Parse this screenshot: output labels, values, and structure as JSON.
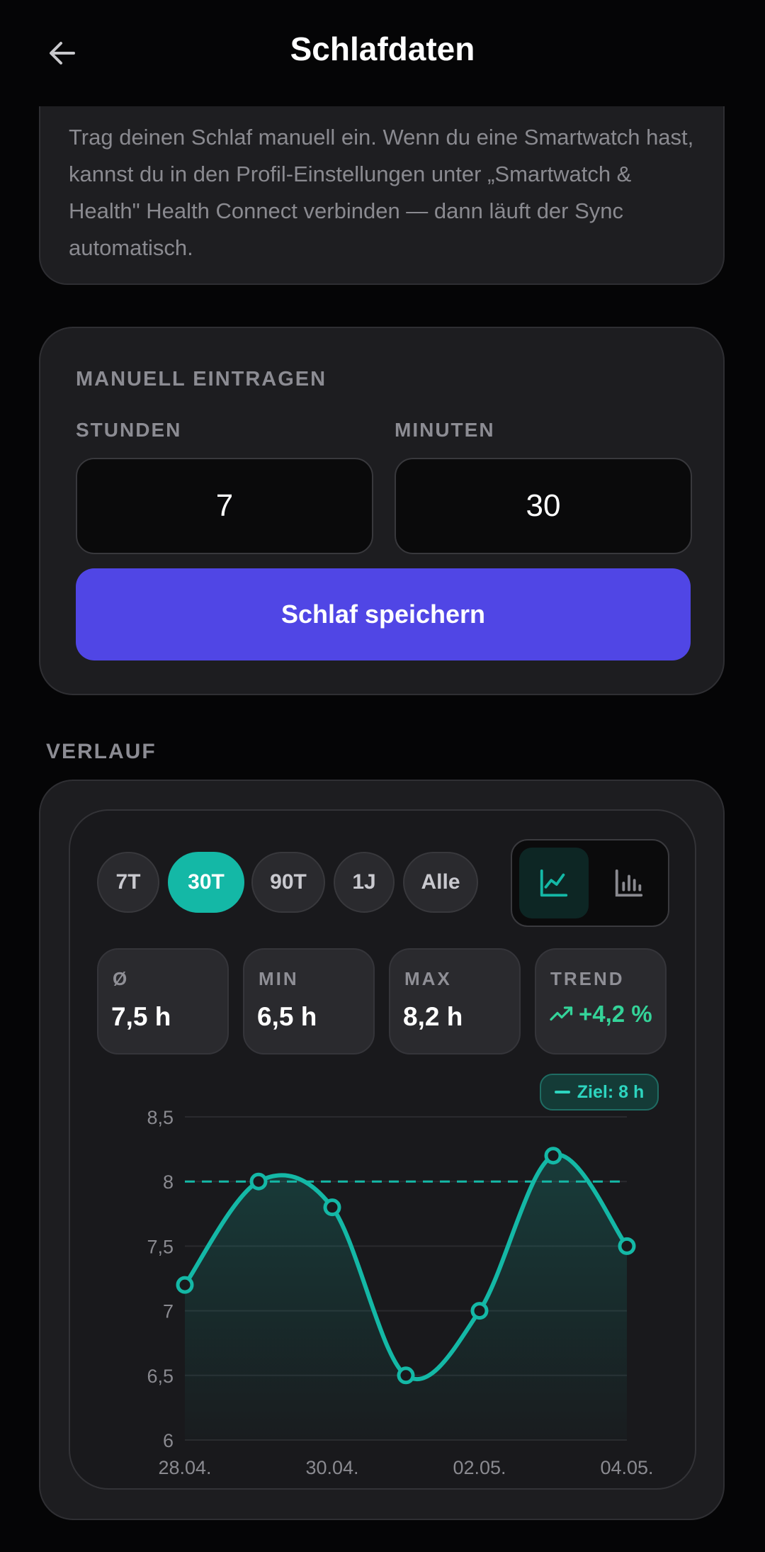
{
  "header": {
    "title": "Schlafdaten"
  },
  "info": {
    "text": "Trag deinen Schlaf manuell ein. Wenn du eine Smartwatch hast, kannst du in den Profil-Einstellungen unter „Smartwatch & Health\" Health Connect verbinden — dann läuft der Sync automatisch."
  },
  "entry": {
    "section_label": "MANUELL EINTRAGEN",
    "hours_label": "STUNDEN",
    "minutes_label": "MINUTEN",
    "hours_value": "7",
    "minutes_value": "30",
    "save_label": "Schlaf speichern"
  },
  "history": {
    "label": "VERLAUF",
    "ranges": [
      {
        "label": "7T",
        "active": false
      },
      {
        "label": "30T",
        "active": true
      },
      {
        "label": "90T",
        "active": false
      },
      {
        "label": "1J",
        "active": false
      },
      {
        "label": "Alle",
        "active": false
      }
    ],
    "view_modes": [
      {
        "icon": "line-chart-icon",
        "active": true
      },
      {
        "icon": "bar-chart-icon",
        "active": false
      }
    ],
    "stats": [
      {
        "label": "Ø",
        "value": "7,5 h"
      },
      {
        "label": "MIN",
        "value": "6,5 h"
      },
      {
        "label": "MAX",
        "value": "8,2 h"
      },
      {
        "label": "TREND",
        "value": "+4,2 %",
        "icon": "trend-up-icon"
      }
    ],
    "goal_badge": "Ziel: 8 h"
  },
  "colors": {
    "accent": "#14b8a6",
    "primary": "#5046e5",
    "trend": "#34d399"
  },
  "chart_data": {
    "type": "line",
    "x": [
      "28.04.",
      "29.04.",
      "30.04.",
      "01.05.",
      "02.05.",
      "03.05.",
      "04.05."
    ],
    "values": [
      7.2,
      8.0,
      7.8,
      6.5,
      7.0,
      8.2,
      7.5
    ],
    "xtick_labels": [
      "28.04.",
      "30.04.",
      "02.05.",
      "04.05."
    ],
    "ytick_labels": [
      "8,5",
      "8",
      "7,5",
      "7",
      "6,5",
      "6"
    ],
    "yticks": [
      8.5,
      8,
      7.5,
      7,
      6.5,
      6
    ],
    "ylim": [
      6,
      8.5
    ],
    "goal": 8,
    "grid": true,
    "title": "",
    "xlabel": "",
    "ylabel": ""
  }
}
